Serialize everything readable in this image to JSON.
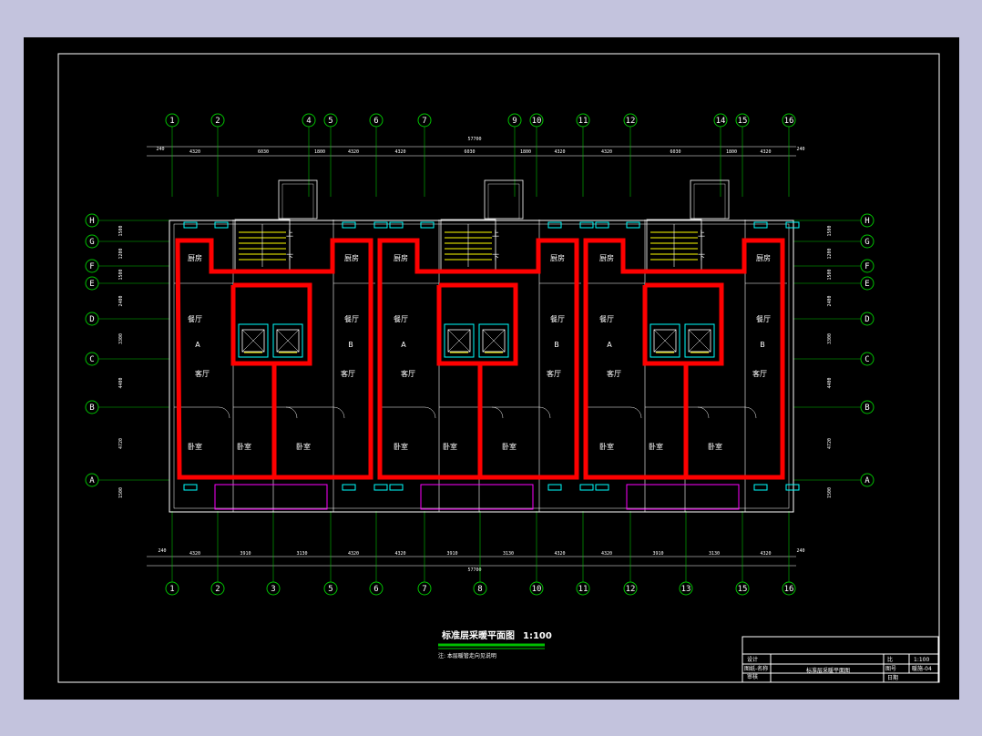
{
  "drawing": {
    "title": "标准层采暖平面图",
    "scale": "1:100",
    "note": "注: 本层暖管走向见说明",
    "colors": {
      "background": "#000000",
      "frame": "#ffffff",
      "axis": "#00c000",
      "walls": "#ffffff",
      "heating_pipe": "#ff0000",
      "windows": "#00ffff",
      "balcony": "#ff00ff",
      "stairs": "#ffff00",
      "title_underline": "#00c000",
      "page_bg": "#c3c3dd"
    }
  },
  "axes": {
    "top": [
      "1",
      "2",
      "4",
      "5",
      "6",
      "7",
      "9",
      "10",
      "11",
      "12",
      "14",
      "15",
      "16"
    ],
    "bottom": [
      "1",
      "2",
      "3",
      "5",
      "6",
      "7",
      "8",
      "10",
      "11",
      "12",
      "13",
      "15",
      "16"
    ],
    "left": [
      "H",
      "G",
      "F",
      "E",
      "D",
      "C",
      "B",
      "A"
    ],
    "right": [
      "H",
      "G",
      "F",
      "E",
      "D",
      "C",
      "B",
      "A"
    ]
  },
  "dimensions": {
    "top_overall": "57700",
    "top_segments": [
      "4320",
      "6030",
      "1800",
      "4320",
      "4320",
      "6030",
      "1800",
      "4320",
      "4320",
      "6030",
      "1800",
      "4320"
    ],
    "bottom_overall": "57700",
    "bottom_segments": [
      "4320",
      "3910",
      "3130",
      "4320",
      "4320",
      "3910",
      "3130",
      "4320",
      "4320",
      "3910",
      "3130",
      "4320"
    ],
    "end_offset": "240",
    "left_segments": [
      "1500",
      "1200",
      "1500",
      "2400",
      "3300",
      "4400",
      "4720",
      "1500"
    ]
  },
  "rooms": {
    "kitchen": "厨房",
    "dining": "餐厅",
    "living": "客厅",
    "bedroom": "卧室",
    "unit_a": "A",
    "unit_b": "B",
    "stair_up": "上",
    "stair_down": "下"
  },
  "title_block": {
    "rows": [
      "设计",
      "图纸-名称",
      "审核"
    ],
    "sheet_name": "标准层采暖平面图",
    "scale_label": "比",
    "scale_value": "1:100",
    "drawing_no_label": "图号",
    "drawing_no": "暖施-04",
    "date_label": "日期"
  }
}
